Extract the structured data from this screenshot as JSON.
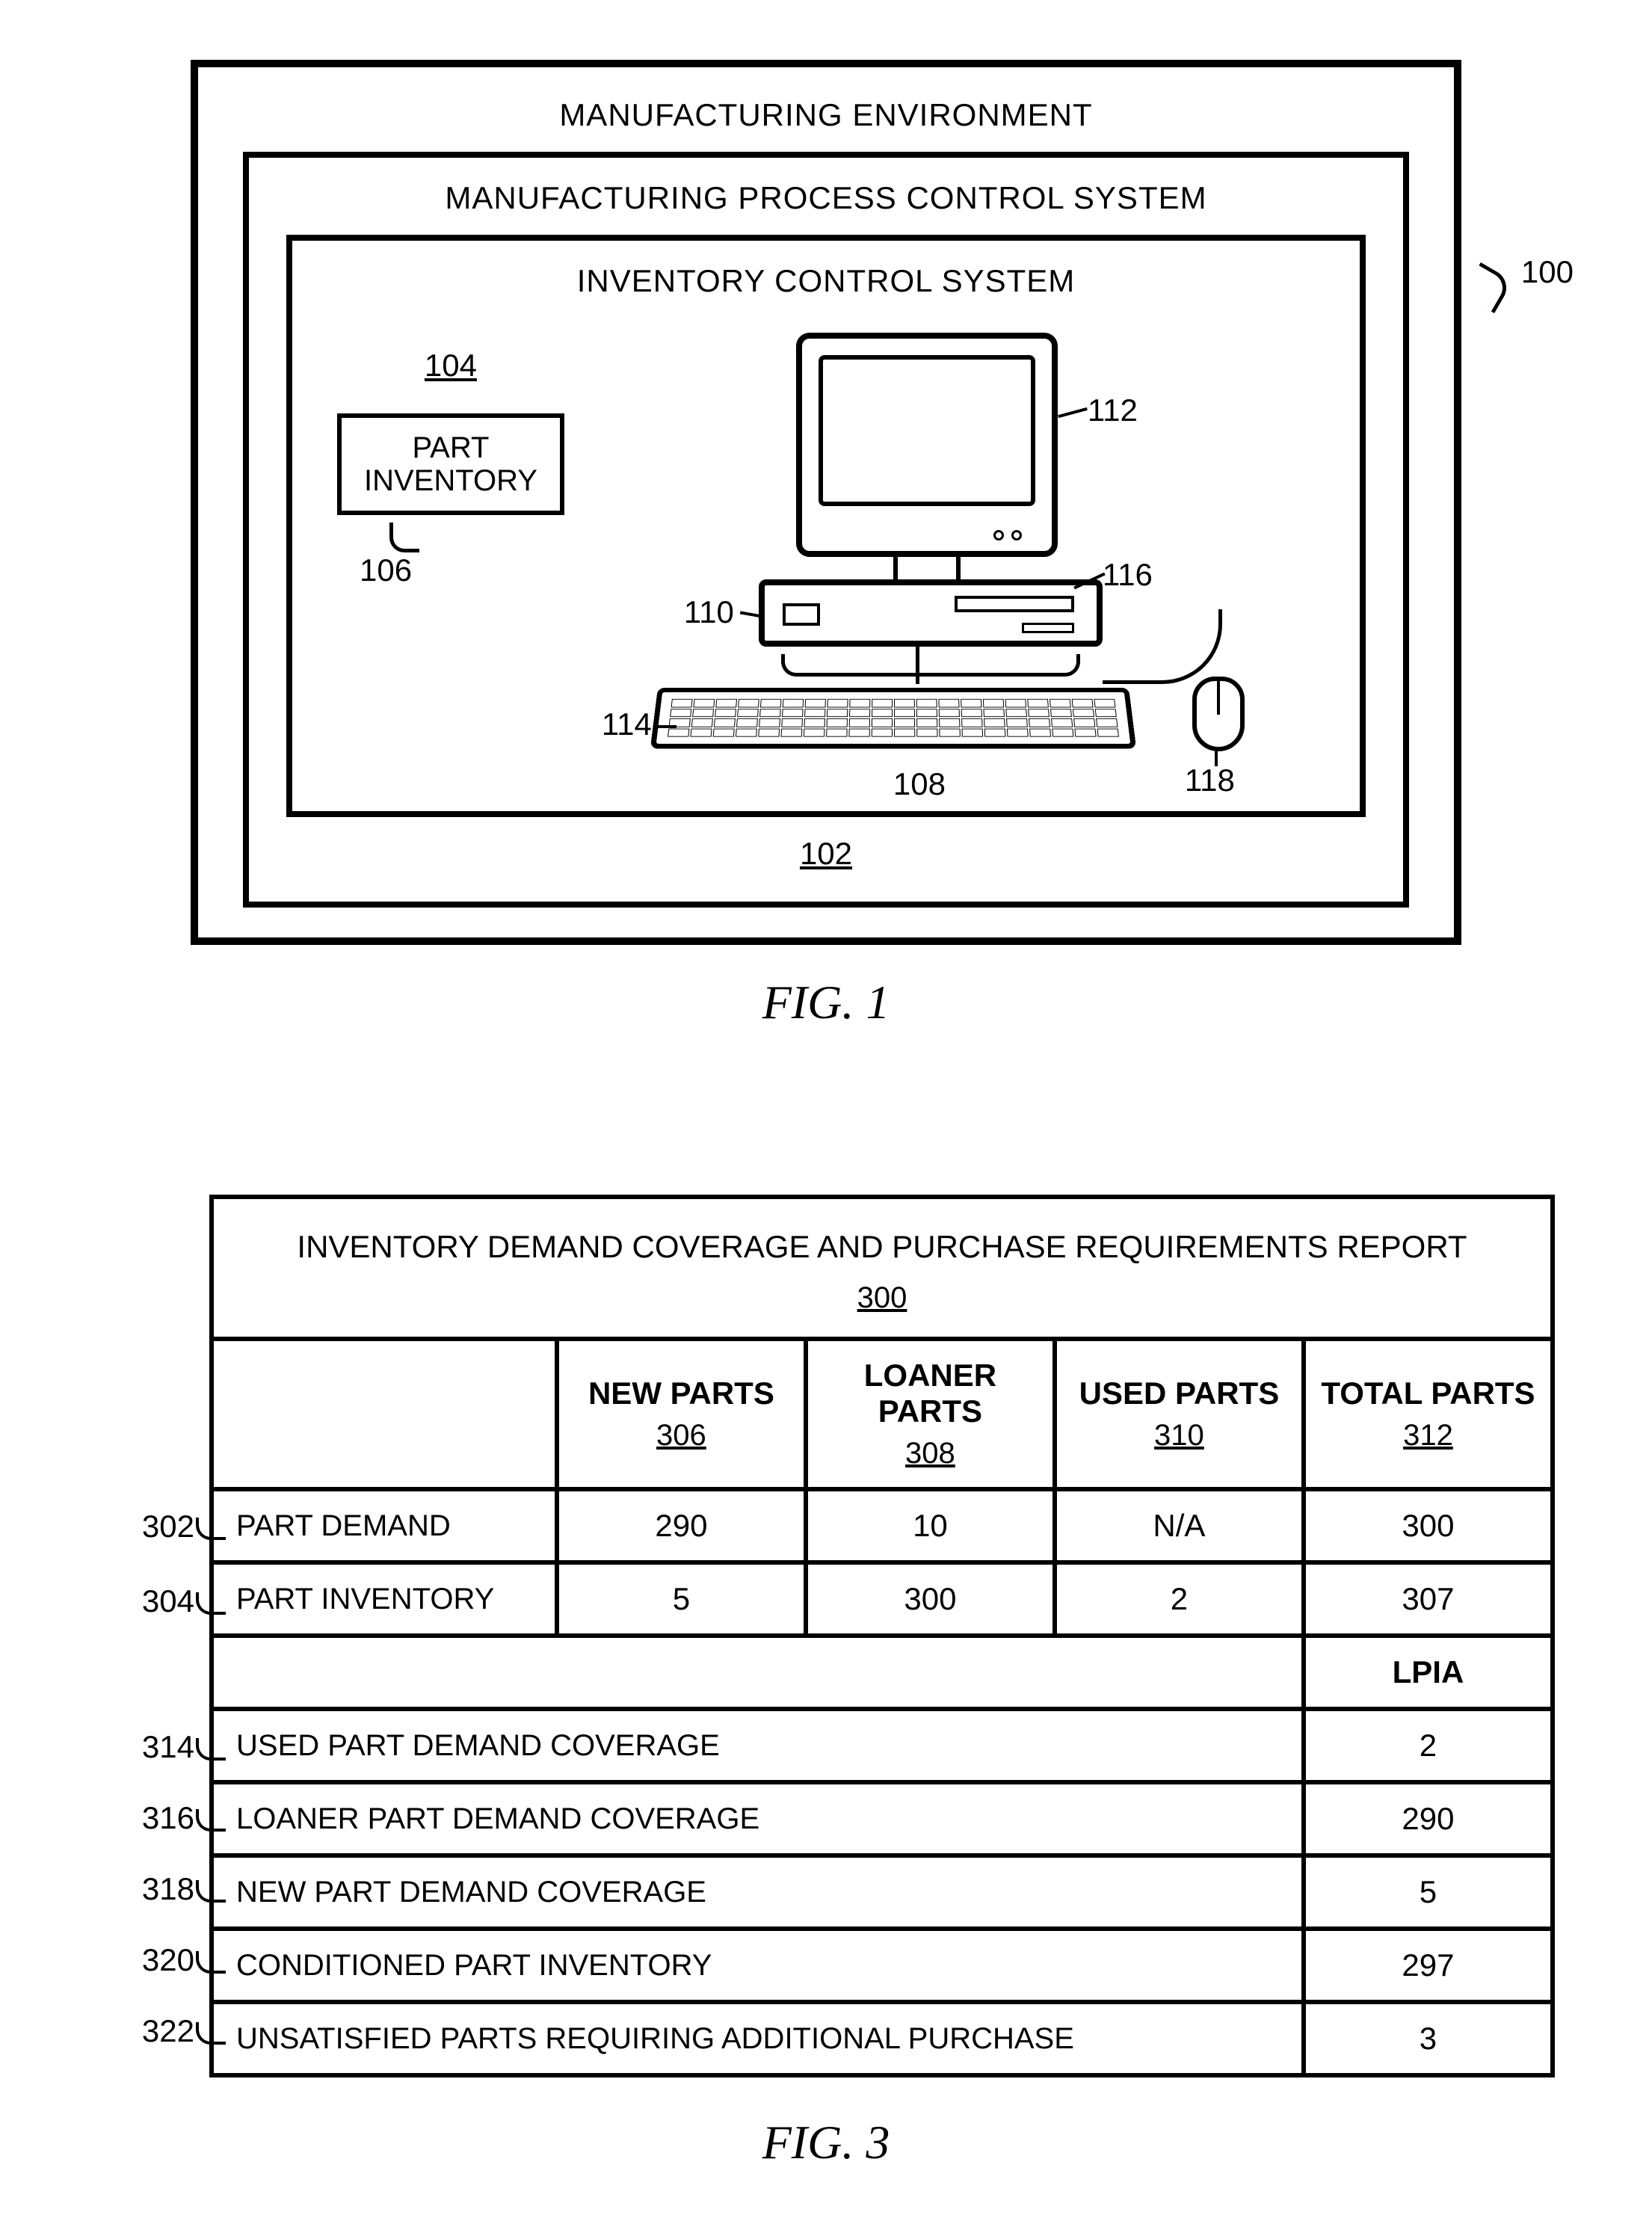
{
  "fig1": {
    "env_title": "MANUFACTURING ENVIRONMENT",
    "mpcs_title": "MANUFACTURING PROCESS CONTROL SYSTEM",
    "ics_title": "INVENTORY CONTROL SYSTEM",
    "part_inventory_label_l1": "PART",
    "part_inventory_label_l2": "INVENTORY",
    "ref_100": "100",
    "ref_102": "102",
    "ref_104": "104",
    "ref_106": "106",
    "ref_108": "108",
    "ref_110": "110",
    "ref_112": "112",
    "ref_114": "114",
    "ref_116": "116",
    "ref_118": "118",
    "caption": "FIG. 1"
  },
  "fig3": {
    "title": "INVENTORY DEMAND COVERAGE AND PURCHASE REQUIREMENTS REPORT",
    "title_ref": "300",
    "columns": {
      "new": {
        "label": "NEW PARTS",
        "ref": "306"
      },
      "loaner": {
        "label": "LOANER PARTS",
        "ref": "308"
      },
      "used": {
        "label": "USED PARTS",
        "ref": "310"
      },
      "total": {
        "label": "TOTAL PARTS",
        "ref": "312"
      }
    },
    "rows": {
      "demand": {
        "label": "PART DEMAND",
        "ref": "302",
        "new": "290",
        "loaner": "10",
        "used": "N/A",
        "total": "300"
      },
      "inventory": {
        "label": "PART INVENTORY",
        "ref": "304",
        "new": "5",
        "loaner": "300",
        "used": "2",
        "total": "307"
      }
    },
    "lpia_header": "LPIA",
    "lpia_rows": [
      {
        "ref": "314",
        "label": "USED PART DEMAND COVERAGE",
        "value": "2"
      },
      {
        "ref": "316",
        "label": "LOANER PART DEMAND COVERAGE",
        "value": "290"
      },
      {
        "ref": "318",
        "label": "NEW PART DEMAND COVERAGE",
        "value": "5"
      },
      {
        "ref": "320",
        "label": "CONDITIONED PART INVENTORY",
        "value": "297"
      },
      {
        "ref": "322",
        "label": "UNSATISFIED PARTS REQUIRING ADDITIONAL PURCHASE",
        "value": "3"
      }
    ],
    "caption": "FIG. 3"
  },
  "chart_data": {
    "type": "table",
    "title": "INVENTORY DEMAND COVERAGE AND PURCHASE REQUIREMENTS REPORT (300)",
    "columns": [
      "",
      "NEW PARTS (306)",
      "LOANER PARTS (308)",
      "USED PARTS (310)",
      "TOTAL PARTS (312)"
    ],
    "rows": [
      [
        "PART DEMAND (302)",
        290,
        10,
        "N/A",
        300
      ],
      [
        "PART INVENTORY (304)",
        5,
        300,
        2,
        307
      ]
    ],
    "lpia": {
      "header": "LPIA",
      "items": [
        {
          "ref": 314,
          "label": "USED PART DEMAND COVERAGE",
          "value": 2
        },
        {
          "ref": 316,
          "label": "LOANER PART DEMAND COVERAGE",
          "value": 290
        },
        {
          "ref": 318,
          "label": "NEW PART DEMAND COVERAGE",
          "value": 5
        },
        {
          "ref": 320,
          "label": "CONDITIONED PART INVENTORY",
          "value": 297
        },
        {
          "ref": 322,
          "label": "UNSATISFIED PARTS REQUIRING ADDITIONAL PURCHASE",
          "value": 3
        }
      ]
    }
  }
}
